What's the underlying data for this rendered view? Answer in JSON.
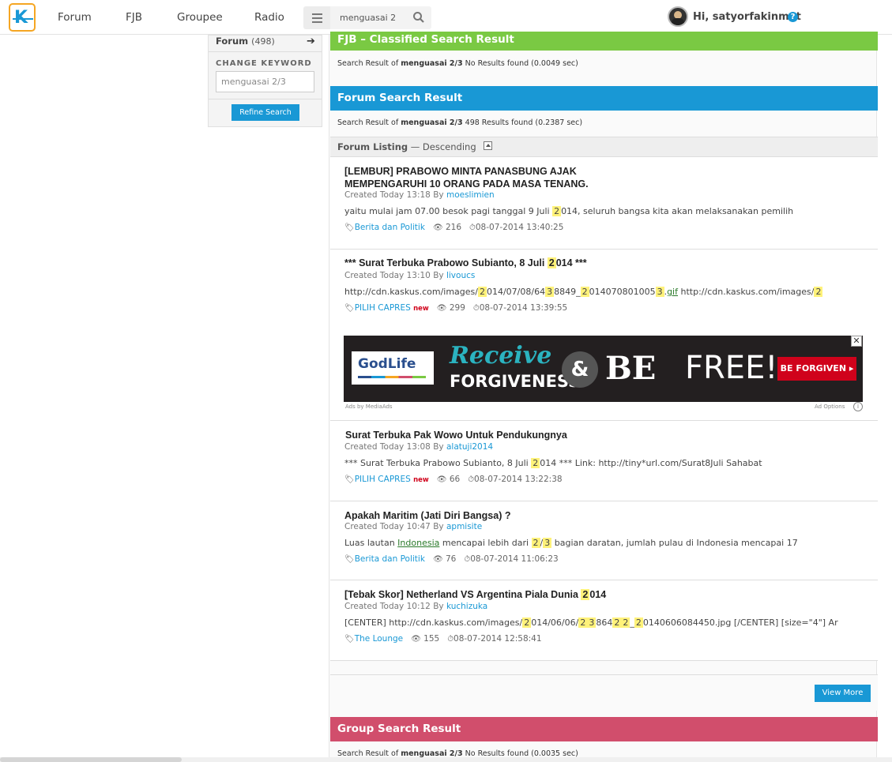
{
  "nav": {
    "items": [
      "Forum",
      "FJB",
      "Groupee",
      "Radio"
    ],
    "search_value": "menguasai 2",
    "greeting": "Hi, satyorfakinmot",
    "help": "?"
  },
  "sidebar": {
    "forum_label": "Forum",
    "forum_count": "(498)",
    "change_keyword_label": "CHANGE KEYWORD",
    "keyword_value": "menguasai 2/3",
    "refine_button": "Refine Search"
  },
  "fjb": {
    "title": "FJB – Classified Search Result",
    "summary_prefix": "Search Result of",
    "keyword": "menguasai 2/3",
    "summary_suffix": " No Results found (0.0049 sec)"
  },
  "forum": {
    "title": "Forum Search Result",
    "summary_prefix": "Search Result of",
    "keyword": "menguasai 2/3",
    "summary_suffix": "498 Results found (0.2387 sec)",
    "listing_label": "Forum Listing",
    "listing_order": "— Descending"
  },
  "threads": [
    {
      "title_line1": "[LEMBUR] PRABOWO MINTA PANASBUNG AJAK",
      "title_line2": "MEMPENGARUHI 10 ORANG PADA MASA TENANG.",
      "created": "Created Today 13:18 By",
      "author": "moeslimien",
      "snippet_a": "yaitu mulai jam 07.00 besok pagi tanggal 9 Juli ",
      "snippet_hl": "2",
      "snippet_b": "014, seluruh bangsa kita akan melaksanakan pemilih",
      "category": "Berita dan Politik",
      "views": "216",
      "date": "08-07-2014 13:40:25"
    },
    {
      "title_a": "*** Surat Terbuka Prabowo Subianto, 8 Juli ",
      "title_hl": "2",
      "title_b": "014 ***",
      "created": "Created Today 13:10 By",
      "author": "livoucs",
      "s1": "http://cdn.kaskus.com/images/",
      "h1": "2",
      "s2": "014/07/08/64",
      "h2": "3",
      "s3": "8849_",
      "h3": "2",
      "s4": "014070801005",
      "h4": "3",
      "s5": ".",
      "link": "gif",
      "s6": " http://cdn.kaskus.com/images/",
      "h5": "2",
      "category": "PILIH CAPRES",
      "badge": "new",
      "views": "299",
      "date": "08-07-2014 13:39:55"
    },
    {
      "title": "Surat Terbuka Pak Wowo Untuk Pendukungnya",
      "created": "Created Today 13:08 By",
      "author": "alatuji2014",
      "snippet_a": "*** Surat Terbuka Prabowo Subianto, 8 Juli ",
      "snippet_hl": "2",
      "snippet_b": "014 *** Link: http://tiny*url.com/Surat8Juli Sahabat",
      "category": "PILIH CAPRES",
      "badge": "new",
      "views": "66",
      "date": "08-07-2014 13:22:38"
    },
    {
      "title": "Apakah Maritim (Jati Diri Bangsa) ?",
      "created": "Created Today 10:47 By",
      "author": "apmisite",
      "s1": "Luas lautan ",
      "link": "Indonesia",
      "s2": " mencapai lebih dari ",
      "h1": "2",
      "s3": "/",
      "h2": "3",
      "s4": " bagian daratan, jumlah pulau di Indonesia mencapai 17",
      "category": "Berita dan Politik",
      "views": "76",
      "date": "08-07-2014 11:06:23"
    },
    {
      "title_a": "[Tebak Skor] Netherland VS Argentina Piala Dunia ",
      "title_hl": "2",
      "title_b": "014",
      "created": "Created Today 10:12 By",
      "author": "kuchizuka",
      "s1": "[CENTER] http://cdn.kaskus.com/images/",
      "h1": "2",
      "s2": "014/06/06/",
      "h2": "2",
      "h3": "3",
      "s3": "864",
      "h4": "2",
      "h5": "2",
      "s4": "_",
      "h6": "2",
      "s5": "0140606084450.jpg [/CENTER] [size=\"4\"] Ar",
      "category": "The Lounge",
      "views": "155",
      "date": "08-07-2014 12:58:41"
    }
  ],
  "ad": {
    "logo": "GodLife",
    "receive": "Receive",
    "forgiveness": "FORGIVENESS",
    "amp": "&",
    "be": "BE",
    "free": "FREE!",
    "cta": "BE FORGIVEN ▸",
    "close": "✕",
    "by": "Ads by MediaAds",
    "options": "Ad Options",
    "info": "i"
  },
  "view_more": "View More",
  "group": {
    "title": "Group Search Result",
    "summary_prefix": "Search Result of",
    "keyword": "menguasai 2/3",
    "summary_suffix": " No Results found (0.0035 sec)"
  },
  "colors": {
    "accent": "#1998d5",
    "fjb": "#7ac943",
    "group": "#d14e6c",
    "highlight": "#fff27a"
  }
}
